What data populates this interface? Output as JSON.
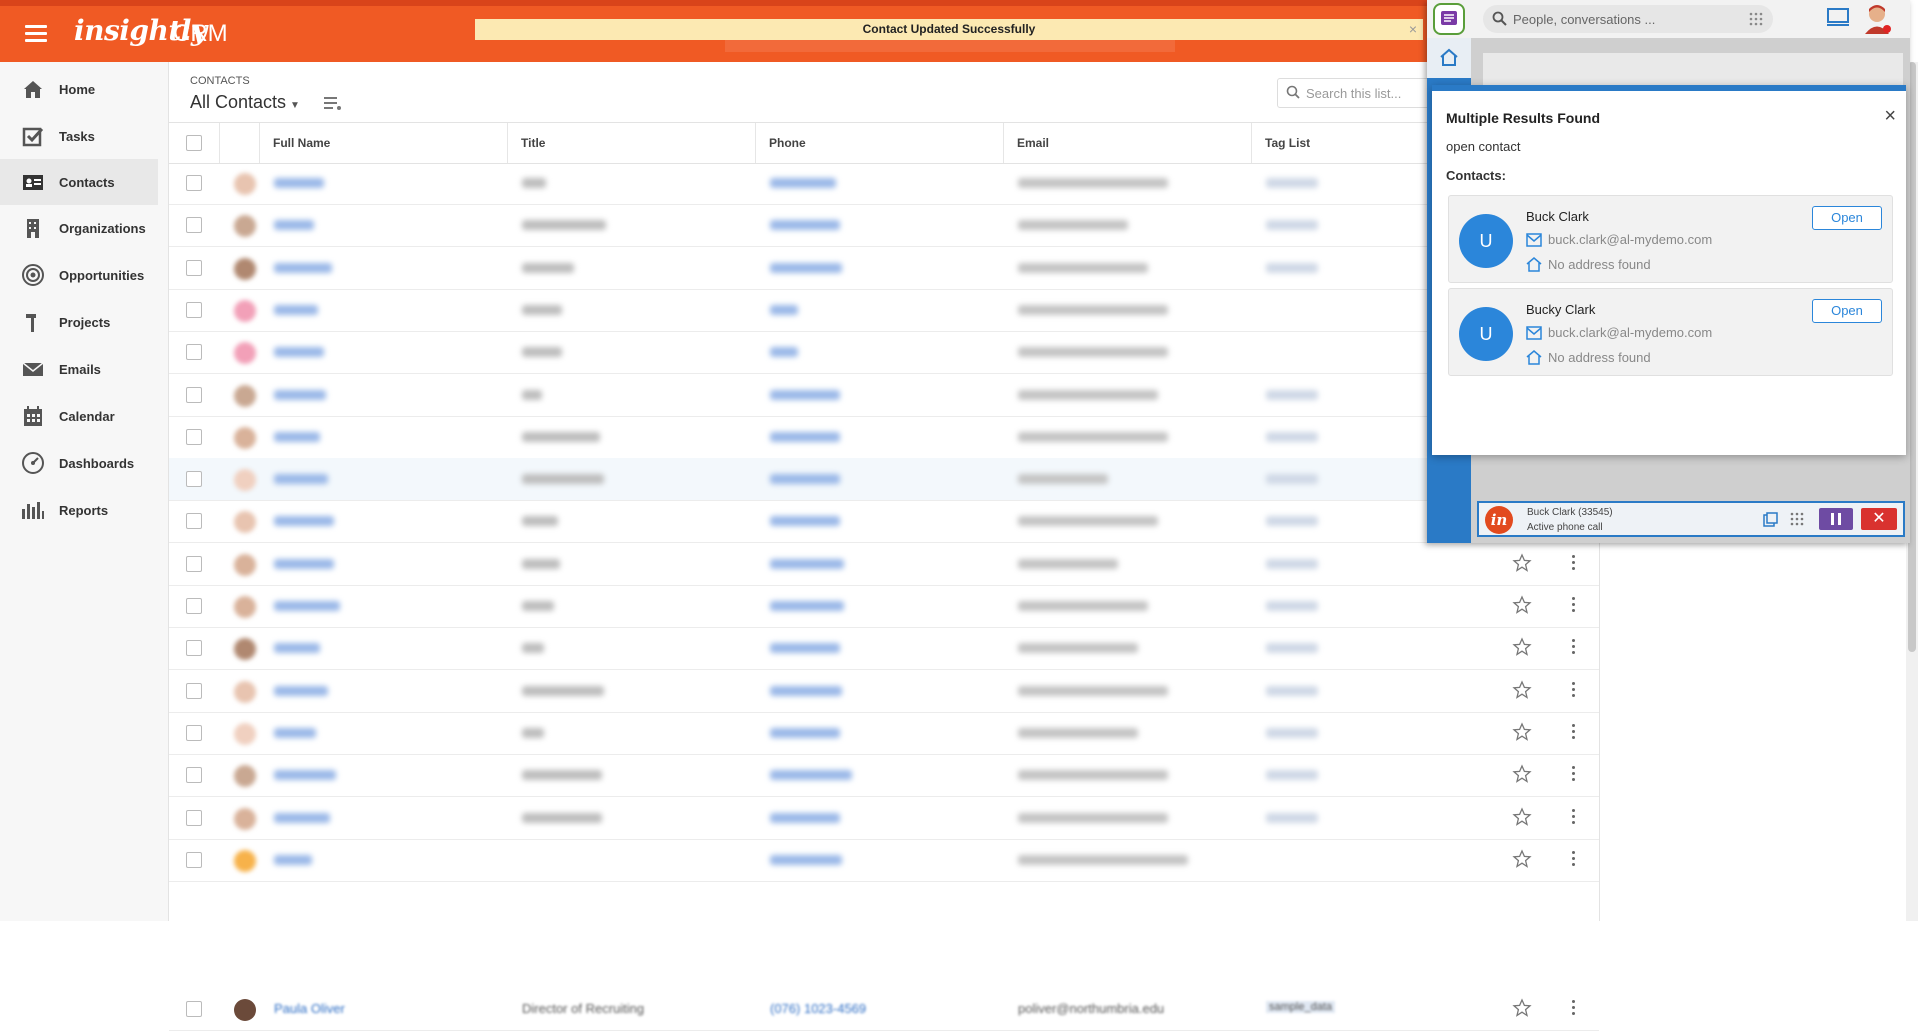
{
  "app": {
    "logo": "insightly",
    "product": "CRM"
  },
  "toast": {
    "message": "Contact Updated Successfully",
    "close": "×"
  },
  "sidebar": {
    "items": [
      {
        "label": "Home",
        "icon": "home-icon"
      },
      {
        "label": "Tasks",
        "icon": "tasks-icon"
      },
      {
        "label": "Contacts",
        "icon": "contacts-icon",
        "active": true
      },
      {
        "label": "Organizations",
        "icon": "organizations-icon"
      },
      {
        "label": "Opportunities",
        "icon": "opportunities-icon"
      },
      {
        "label": "Projects",
        "icon": "projects-icon"
      },
      {
        "label": "Emails",
        "icon": "emails-icon"
      },
      {
        "label": "Calendar",
        "icon": "calendar-icon"
      },
      {
        "label": "Dashboards",
        "icon": "dashboards-icon"
      },
      {
        "label": "Reports",
        "icon": "reports-icon"
      }
    ]
  },
  "list": {
    "breadcrumb": "CONTACTS",
    "view": "All Contacts",
    "search_placeholder": "Search this list...",
    "columns": [
      "Full Name",
      "Title",
      "Phone",
      "Email",
      "Tag List"
    ],
    "last_row": {
      "name": "Paula Oliver",
      "title": "Director of Recruiting",
      "phone": "(076) 1023-4569",
      "email": "poliver@northumbria.edu",
      "tag": "sample_data"
    }
  },
  "phone_widget": {
    "search_placeholder": "People, conversations ...",
    "modal": {
      "title": "Multiple Results Found",
      "subtitle": "open contact",
      "contacts_label": "Contacts:",
      "close": "×",
      "results": [
        {
          "initial": "U",
          "name": "Buck Clark",
          "email": "buck.clark@al-mydemo.com",
          "address": "No address found",
          "open_label": "Open"
        },
        {
          "initial": "U",
          "name": "Bucky Clark",
          "email": "buck.clark@al-mydemo.com",
          "address": "No address found",
          "open_label": "Open"
        }
      ]
    },
    "call": {
      "caller": "Buck Clark (33545)",
      "status": "Active phone call",
      "hangup": "✕"
    }
  },
  "colors": {
    "brand_orange": "#f05a24",
    "accent_blue": "#2b86da",
    "pause_purple": "#6e4ba3",
    "hangup_red": "#d9322f",
    "toast_bg": "#fce9b2"
  }
}
